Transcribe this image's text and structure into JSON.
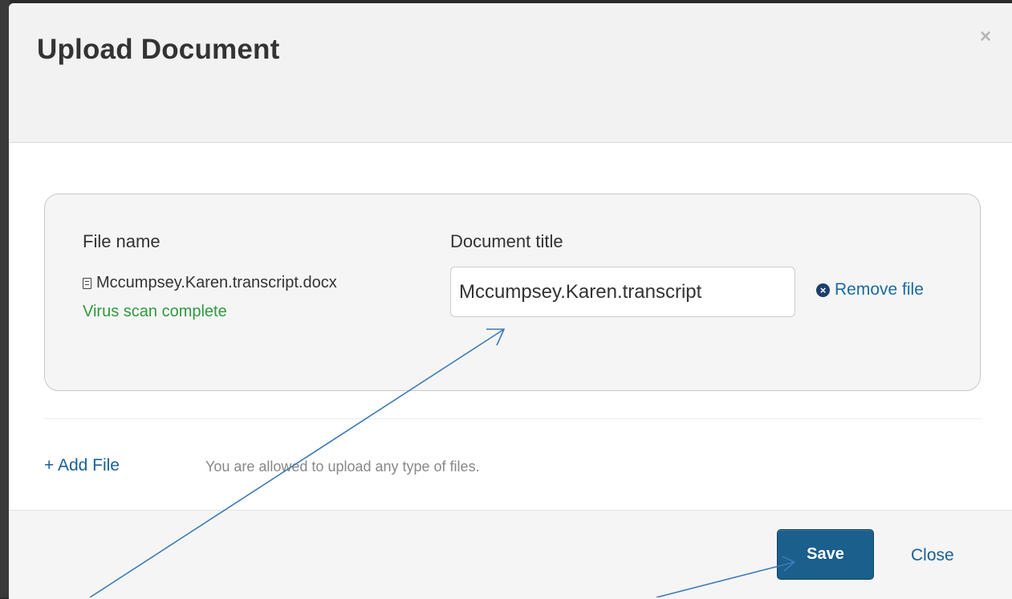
{
  "modal": {
    "title": "Upload Document",
    "close_glyph": "×"
  },
  "file_panel": {
    "file_name_label": "File name",
    "document_title_label": "Document title",
    "file": {
      "icon": "document-icon",
      "name": "Mccumpsey.Karen.transcript.docx",
      "scan_status": "Virus scan complete",
      "title_value": "Mccumpsey.Karen.transcript"
    },
    "remove": {
      "icon": "circle-x-icon",
      "icon_glyph": "×",
      "label": "Remove file"
    }
  },
  "upload": {
    "add_file_label": "+ Add File",
    "help_text": "You are allowed to upload any type of files."
  },
  "footer": {
    "save_label": "Save",
    "close_label": "Close"
  },
  "annotation": {
    "arrow_color": "#3d7ab5"
  }
}
